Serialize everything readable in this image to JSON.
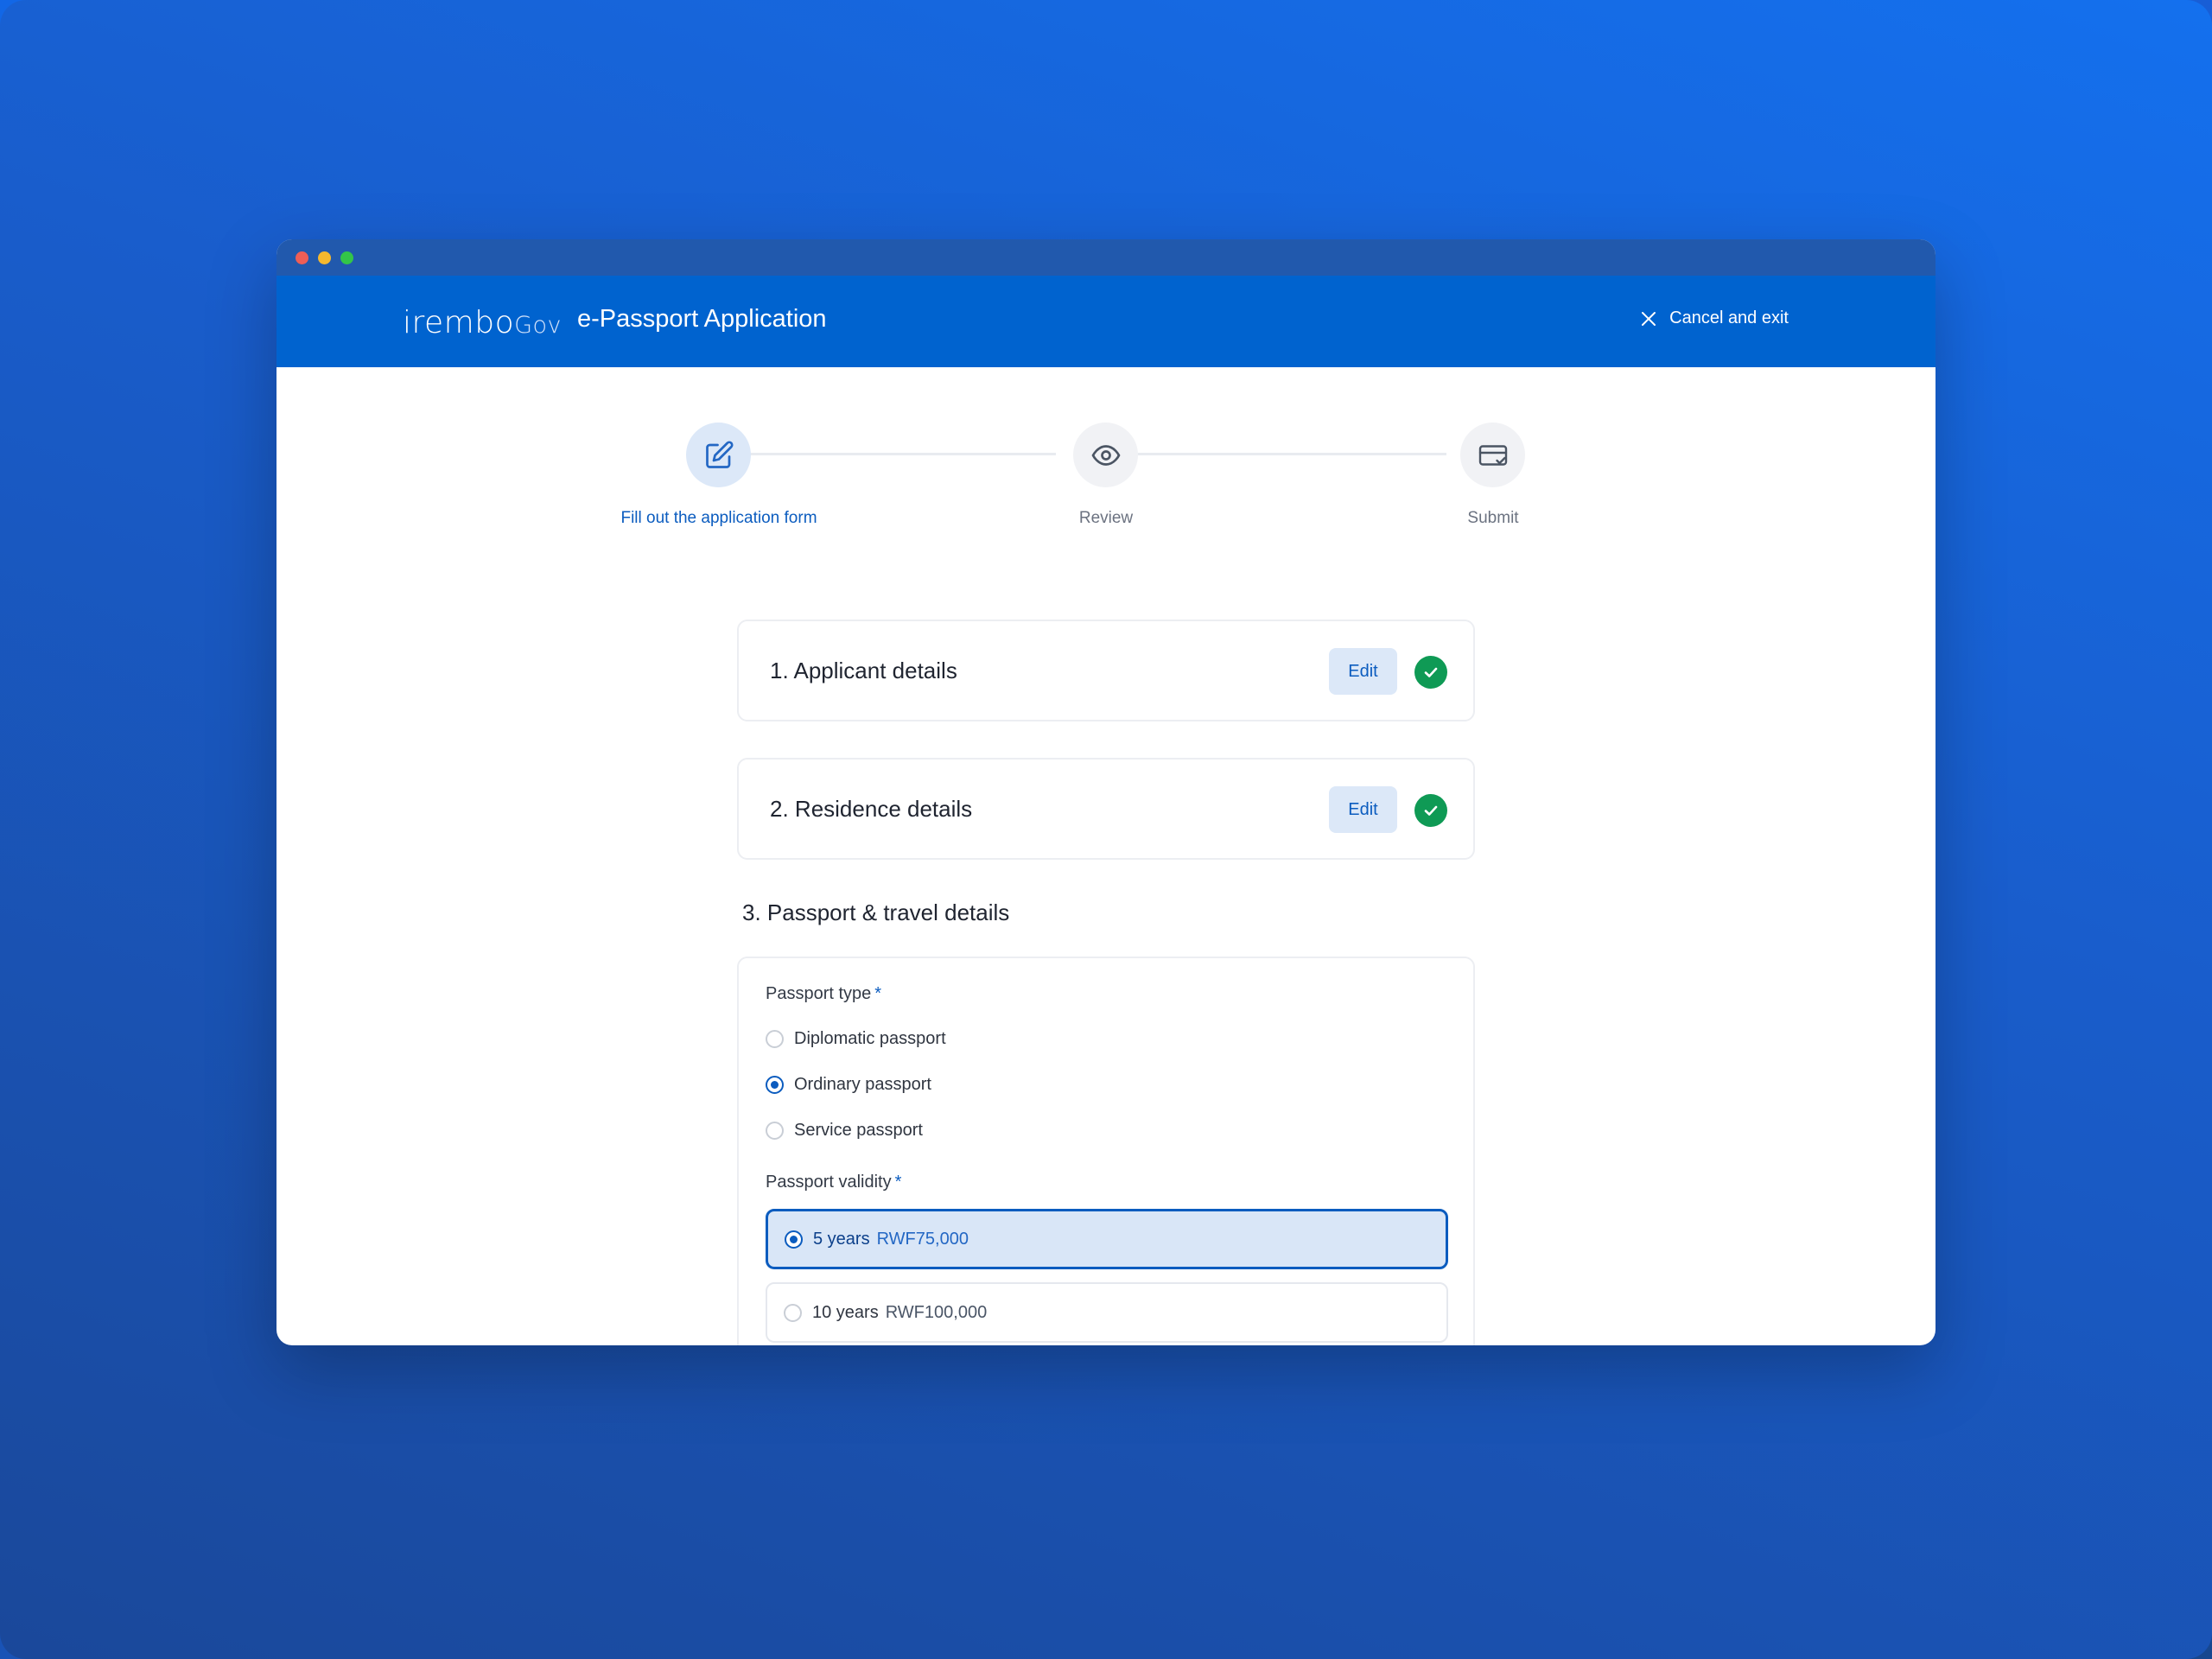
{
  "window": {
    "controls": [
      "close",
      "minimize",
      "maximize"
    ]
  },
  "header": {
    "logo_main": "irembo",
    "logo_sub": "Gov",
    "title": "e-Passport Application",
    "cancel_label": "Cancel and exit"
  },
  "stepper": {
    "steps": [
      {
        "label": "Fill out the application form",
        "icon": "edit-icon",
        "active": true
      },
      {
        "label": "Review",
        "icon": "eye-icon",
        "active": false
      },
      {
        "label": "Submit",
        "icon": "card-check-icon",
        "active": false
      }
    ]
  },
  "sections": [
    {
      "number": "1.",
      "title": "Applicant details",
      "edit_label": "Edit",
      "complete": true
    },
    {
      "number": "2.",
      "title": "Residence details",
      "edit_label": "Edit",
      "complete": true
    },
    {
      "number": "3.",
      "title": "Passport & travel details"
    }
  ],
  "form": {
    "passport_type": {
      "label": "Passport type",
      "required_mark": "*",
      "options": [
        {
          "label": "Diplomatic passport",
          "selected": false
        },
        {
          "label": "Ordinary passport",
          "selected": true
        },
        {
          "label": "Service passport",
          "selected": false
        }
      ]
    },
    "passport_validity": {
      "label": "Passport validity",
      "required_mark": "*",
      "options": [
        {
          "term": "5 years",
          "price": "RWF75,000",
          "selected": true
        },
        {
          "term": "10 years",
          "price": "RWF100,000",
          "selected": false
        }
      ]
    }
  },
  "colors": {
    "brand_blue": "#0063cf",
    "accent": "#0b5cbf",
    "success": "#0f9a55"
  }
}
